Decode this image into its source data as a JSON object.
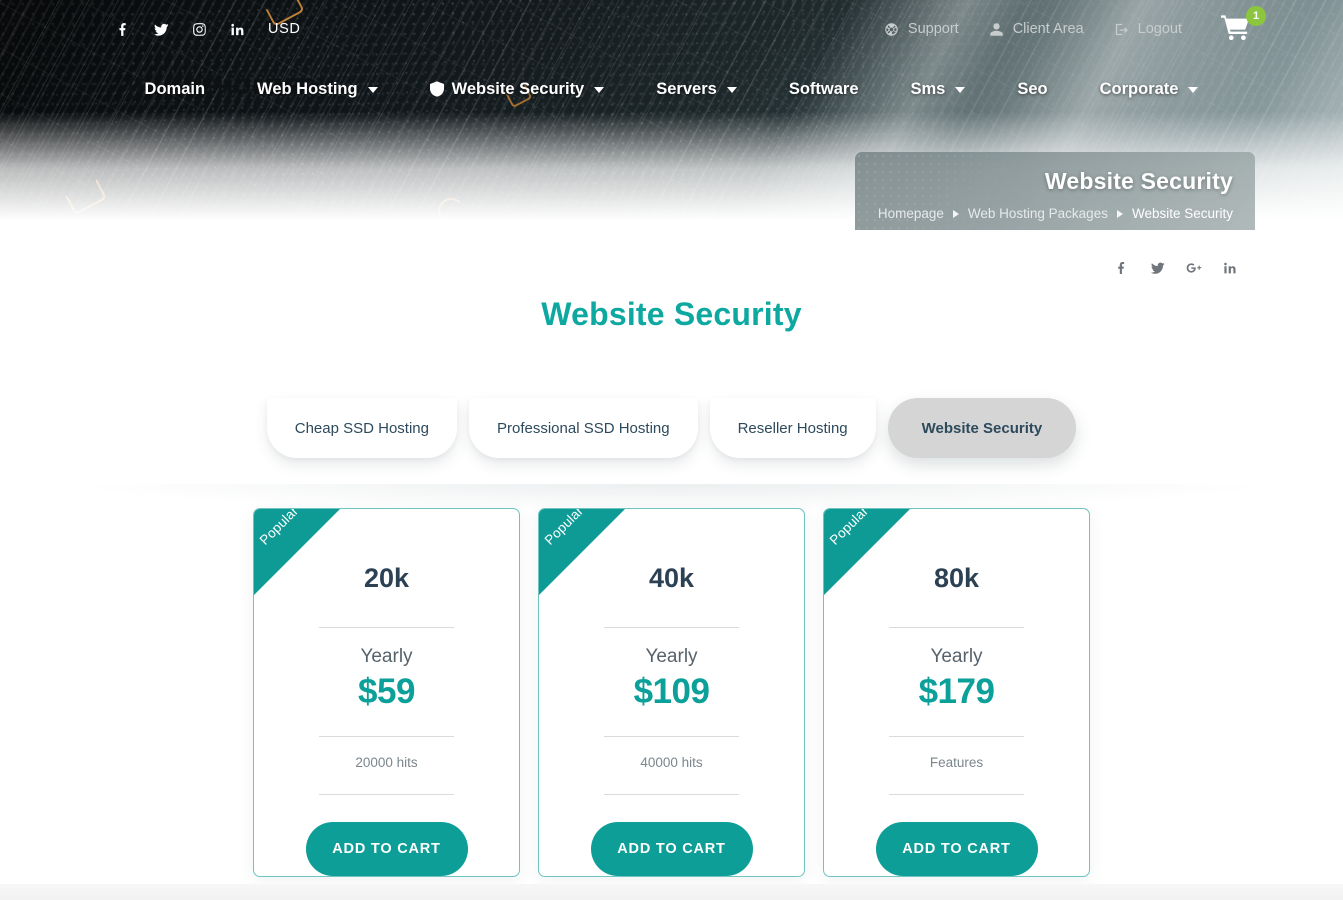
{
  "topbar": {
    "social": [
      {
        "name": "facebook-icon",
        "label": "f"
      },
      {
        "name": "twitter-icon",
        "label": "t"
      },
      {
        "name": "instagram-icon",
        "label": "ig"
      },
      {
        "name": "linkedin-icon",
        "label": "in"
      }
    ],
    "currency": "USD",
    "logo_placeholder": "[PLACEHOLDER]",
    "links": [
      {
        "label": "Support",
        "icon": "lifebuoy-icon"
      },
      {
        "label": "Client Area",
        "icon": "user-icon"
      },
      {
        "label": "Logout",
        "icon": "logout-icon"
      }
    ],
    "cart": {
      "icon": "shopping-cart-icon",
      "count": "1"
    }
  },
  "nav": {
    "items": [
      {
        "label": "Domain",
        "caret": false,
        "icon": null
      },
      {
        "label": "Web Hosting",
        "caret": true,
        "icon": null
      },
      {
        "label": "Website Security",
        "caret": true,
        "icon": "shield-icon"
      },
      {
        "label": "Servers",
        "caret": true,
        "icon": null
      },
      {
        "label": "Software",
        "caret": false,
        "icon": null
      },
      {
        "label": "Sms",
        "caret": true,
        "icon": null
      },
      {
        "label": "Seo",
        "caret": false,
        "icon": null
      },
      {
        "label": "Corporate",
        "caret": true,
        "icon": null
      }
    ]
  },
  "hero": {
    "panel_title": "Website Security",
    "breadcrumb": [
      "Homepage",
      "Web Hosting Packages",
      "Website Security"
    ]
  },
  "share": {
    "items": [
      {
        "name": "facebook-share-icon"
      },
      {
        "name": "twitter-share-icon"
      },
      {
        "name": "googleplus-share-icon"
      },
      {
        "name": "linkedin-share-icon"
      }
    ]
  },
  "page": {
    "title": "Website Security"
  },
  "tabs": [
    {
      "label": "Cheap SSD Hosting",
      "active": false
    },
    {
      "label": "Professional SSD Hosting",
      "active": false
    },
    {
      "label": "Reseller Hosting",
      "active": false
    },
    {
      "label": "Website Security",
      "active": true
    }
  ],
  "plans": [
    {
      "ribbon": "Popular",
      "quantity": "20k",
      "period": "Yearly",
      "price": "$59",
      "feature": "20000 hits",
      "button": "ADD TO CART"
    },
    {
      "ribbon": "Popular",
      "quantity": "40k",
      "period": "Yearly",
      "price": "$109",
      "feature": "40000 hits",
      "button": "ADD TO CART"
    },
    {
      "ribbon": "Popular",
      "quantity": "80k",
      "period": "Yearly",
      "price": "$179",
      "feature": "Features",
      "button": "ADD TO CART"
    }
  ],
  "colors": {
    "accent_teal": "#0da8a0",
    "button_teal": "#0d9e98",
    "card_border": "#6fc3c0",
    "tab_text": "#2d4a5c",
    "tab_active_bg": "#d5d5d5",
    "cart_badge_green": "#8cc63e",
    "heading_dark": "#2c4254"
  }
}
